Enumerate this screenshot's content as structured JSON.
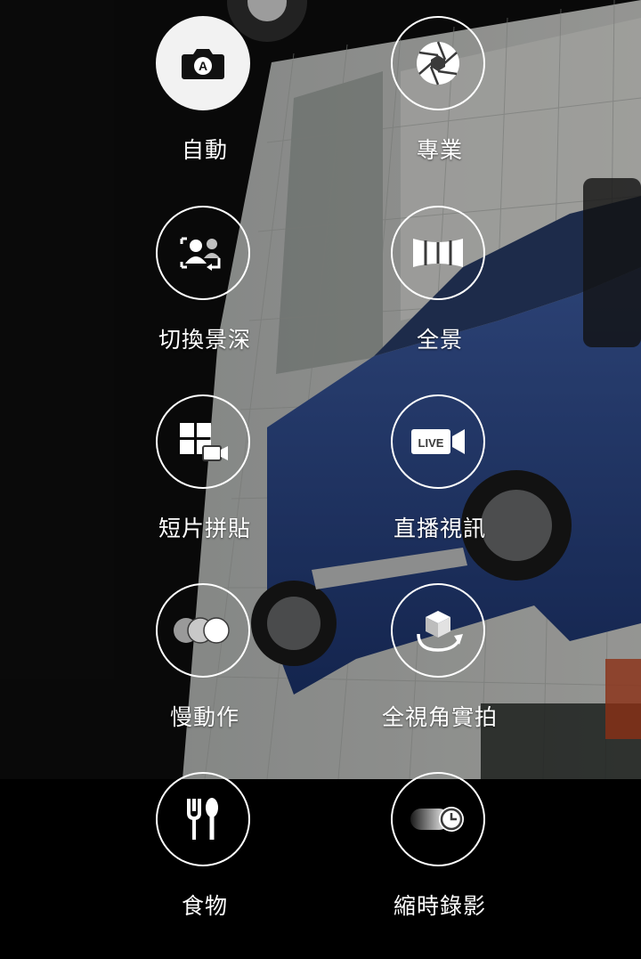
{
  "modes": [
    {
      "id": "auto",
      "label": "自動",
      "icon": "auto-camera-icon",
      "selected": true
    },
    {
      "id": "pro",
      "label": "專業",
      "icon": "aperture-icon",
      "selected": false
    },
    {
      "id": "selective-focus",
      "label": "切換景深",
      "icon": "selective-focus-icon",
      "selected": false
    },
    {
      "id": "panorama",
      "label": "全景",
      "icon": "panorama-icon",
      "selected": false
    },
    {
      "id": "video-collage",
      "label": "短片拼貼",
      "icon": "video-collage-icon",
      "selected": false
    },
    {
      "id": "live-broadcast",
      "label": "直播視訊",
      "icon": "live-broadcast-icon",
      "selected": false
    },
    {
      "id": "slow-motion",
      "label": "慢動作",
      "icon": "slow-motion-icon",
      "selected": false
    },
    {
      "id": "surround-shot",
      "label": "全視角實拍",
      "icon": "surround-shot-icon",
      "selected": false
    },
    {
      "id": "food",
      "label": "食物",
      "icon": "food-icon",
      "selected": false
    },
    {
      "id": "hyperlapse",
      "label": "縮時錄影",
      "icon": "hyperlapse-icon",
      "selected": false
    }
  ],
  "icon_glyphs": {
    "auto": "A",
    "live": "LIVE"
  },
  "colors": {
    "selected_background": "#f2f2f2",
    "ring": "#ffffff",
    "label": "#ffffff",
    "bottom_bar": "#000000"
  }
}
